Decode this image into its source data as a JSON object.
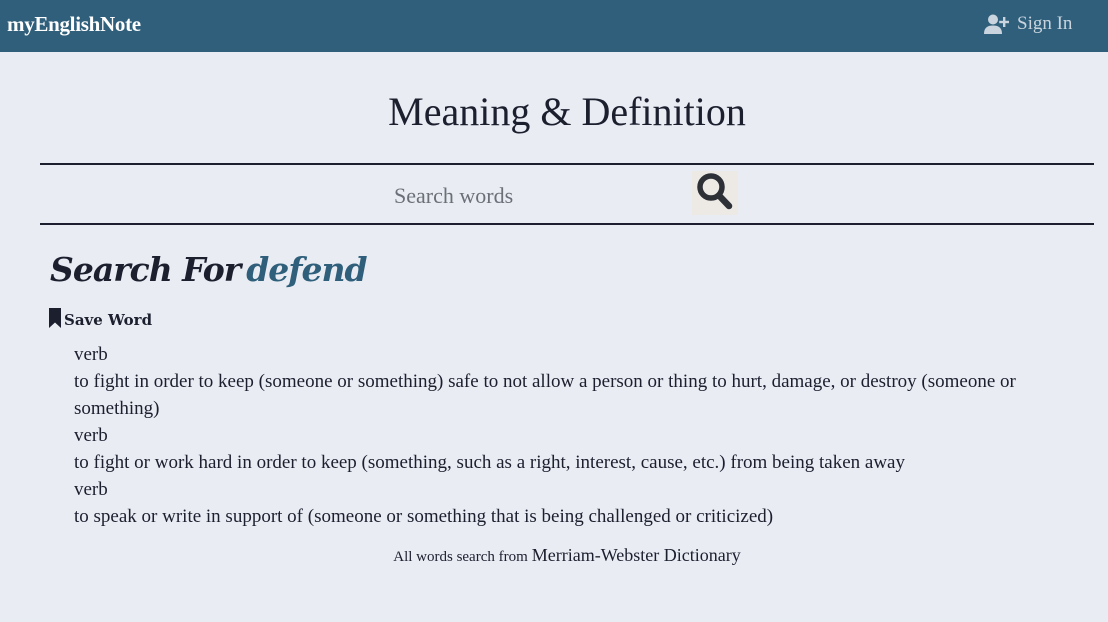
{
  "navbar": {
    "brand": "myEnglishNote",
    "signin_label": "Sign In",
    "signin_icon": "user-plus-icon"
  },
  "page": {
    "title": "Meaning & Definition"
  },
  "search": {
    "placeholder": "Search words",
    "value": "",
    "button_icon": "search-icon"
  },
  "result": {
    "heading_prefix": "Search For",
    "word": "defend",
    "save_label": "Save Word",
    "save_icon": "bookmark-icon",
    "definitions": [
      {
        "pos": "verb",
        "text": "to fight in order to keep (someone or something) safe to not allow a person or thing to hurt, damage, or destroy (someone or something)"
      },
      {
        "pos": "verb",
        "text": "to fight or work hard in order to keep (something, such as a right, interest, cause, etc.) from being taken away"
      },
      {
        "pos": "verb",
        "text": "to speak or write in support of (someone or something that is being challenged or criticized)"
      }
    ]
  },
  "footer": {
    "prefix": "All words search from",
    "source": "Merriam-Webster Dictionary"
  },
  "colors": {
    "navbar_bg": "#2f5f7b",
    "page_bg": "#e9ecf3",
    "accent_word": "#2f5f7b",
    "text": "#1c1f2e"
  }
}
